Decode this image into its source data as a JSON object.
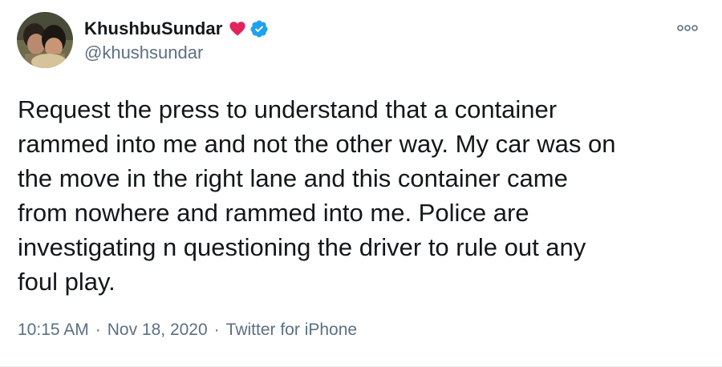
{
  "author": {
    "display_name": "KhushbuSundar",
    "handle": "@khushsundar",
    "heart_color": "#e0245e",
    "verified_color": "#1da1f2"
  },
  "icons": {
    "heart": "heart-icon",
    "verified": "verified-badge-icon",
    "more": "more-options-icon"
  },
  "tweet": {
    "text": "Request the press to understand that a container\nrammed into me and not the other way. My car was on\nthe move in the right lane and this container came\nfrom nowhere and rammed into me. Police are\ninvestigating n questioning the driver to rule out any\nfoul play."
  },
  "meta": {
    "time": "10:15 AM",
    "separator": "·",
    "date": "Nov 18, 2020",
    "source": "Twitter for iPhone"
  }
}
